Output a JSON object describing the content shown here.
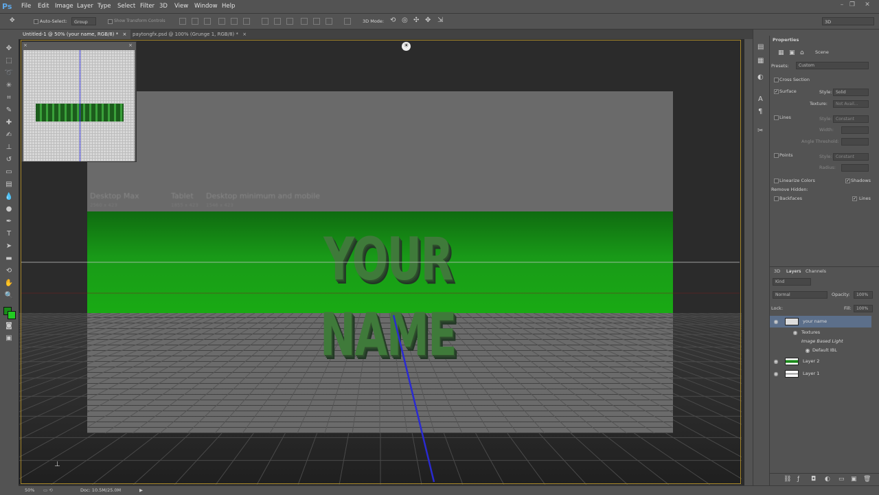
{
  "app": {
    "logo": "Ps"
  },
  "menu": [
    "File",
    "Edit",
    "Image",
    "Layer",
    "Type",
    "Select",
    "Filter",
    "3D",
    "View",
    "Window",
    "Help"
  ],
  "options_bar": {
    "auto_select_label": "Auto-Select:",
    "auto_select_value": "Group",
    "show_transform_label": "Show Transform Controls",
    "mode_3d_label": "3D Mode:",
    "workspace_value": "3D"
  },
  "tabs": [
    {
      "label": "Untitled-1 @ 50% (your name, RGB/8) *"
    },
    {
      "label": "paytongfx.psd @ 100% (Grunge 1, RGB/8) *"
    }
  ],
  "canvas": {
    "guide_labels": [
      "Desktop Max",
      "Tablet",
      "Desktop minimum and mobile"
    ],
    "guide_sizes": [
      "2560 x 423",
      "1855 x 423",
      "1546 x 423"
    ],
    "banner_text": "YOUR NAME"
  },
  "properties": {
    "panel_title": "Properties",
    "section": "Scene",
    "presets_label": "Presets:",
    "presets_value": "Custom",
    "cross_section_label": "Cross Section",
    "surface_label": "Surface",
    "surface_style_label": "Style:",
    "surface_style_value": "Solid",
    "texture_label": "Texture:",
    "texture_value": "Not Avail...",
    "lines_label": "Lines",
    "lines_style_label": "Style:",
    "lines_style_value": "Constant",
    "width_label": "Width:",
    "angle_threshold_label": "Angle Threshold:",
    "points_label": "Points",
    "points_style_label": "Style:",
    "points_style_value": "Constant",
    "radius_label": "Radius:",
    "linearize_label": "Linearize Colors",
    "shadows_label": "Shadows",
    "remove_hidden_label": "Remove Hidden:",
    "backfaces_label": "Backfaces",
    "lines_check_label": "Lines"
  },
  "layers": {
    "tabs": [
      "3D",
      "Layers",
      "Channels"
    ],
    "kind_label": "Kind",
    "blend_mode": "Normal",
    "opacity_label": "Opacity:",
    "opacity_value": "100%",
    "lock_label": "Lock:",
    "fill_label": "Fill:",
    "fill_value": "100%",
    "items": [
      {
        "name": "your name"
      },
      {
        "name": "Textures"
      },
      {
        "name": "Image Based Light"
      },
      {
        "name": "Default IBL"
      },
      {
        "name": "Layer 2"
      },
      {
        "name": "Layer 1"
      }
    ]
  },
  "status": {
    "zoom": "50%",
    "doc": "Doc: 10.5M/25.0M"
  },
  "colors": {
    "accent_green": "#19aa14",
    "frame": "#a8882a",
    "guide_blue": "#2a2ad0"
  }
}
